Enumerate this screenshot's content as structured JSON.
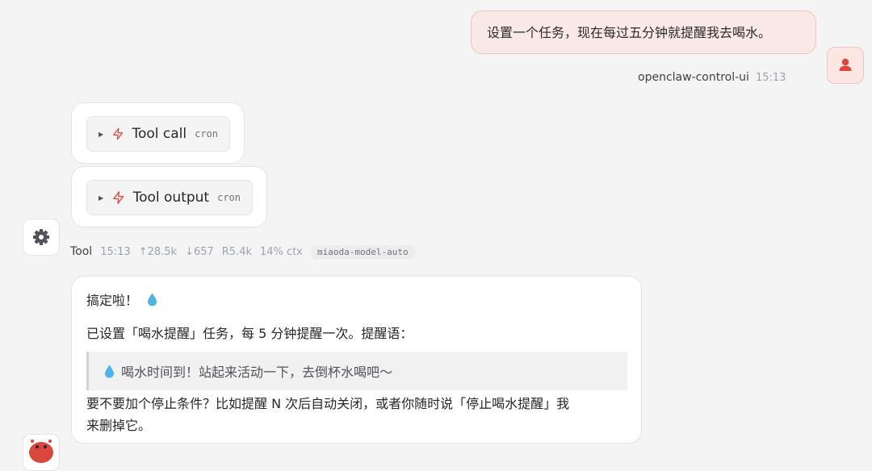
{
  "user_message": {
    "text": "设置一个任务，现在每过五分钟就提醒我去喝水。",
    "sender": "openclaw-control-ui",
    "time": "15:13",
    "avatar_icon": "user-icon"
  },
  "tool_calls": [
    {
      "label": "Tool call",
      "tag": "cron",
      "icon": "bolt-icon",
      "expand_icon": "triangle-right-icon"
    },
    {
      "label": "Tool output",
      "tag": "cron",
      "icon": "bolt-icon",
      "expand_icon": "triangle-right-icon"
    }
  ],
  "tool_meta": {
    "avatar_icon": "gear-icon",
    "name": "Tool",
    "time": "15:13",
    "tokens_in": "↑28.5k",
    "tokens_out": "↓657",
    "reasoning": "R5.4k",
    "context": "14% ctx",
    "model": "miaoda-model-auto"
  },
  "assistant_message": {
    "line1": "搞定啦！",
    "line2": "已设置「喝水提醒」任务，每 5 分钟提醒一次。提醒语：",
    "quote": "喝水时间到！站起来活动一下，去倒杯水喝吧～",
    "line3": "要不要加个停止条件？比如提醒 N 次后自动关闭，或者你随时说「停止喝水提醒」我",
    "line4": "来删掉它。",
    "emoji_icon": "water-drop-icon",
    "avatar_icon": "bot-avatar-icon"
  },
  "colors": {
    "accent": "#d9473f",
    "user_bubble_bg": "#f9e8e6",
    "user_bubble_border": "#efc3c0",
    "page_bg": "#f4f4f5",
    "water_drop": "#4fb3e8"
  }
}
